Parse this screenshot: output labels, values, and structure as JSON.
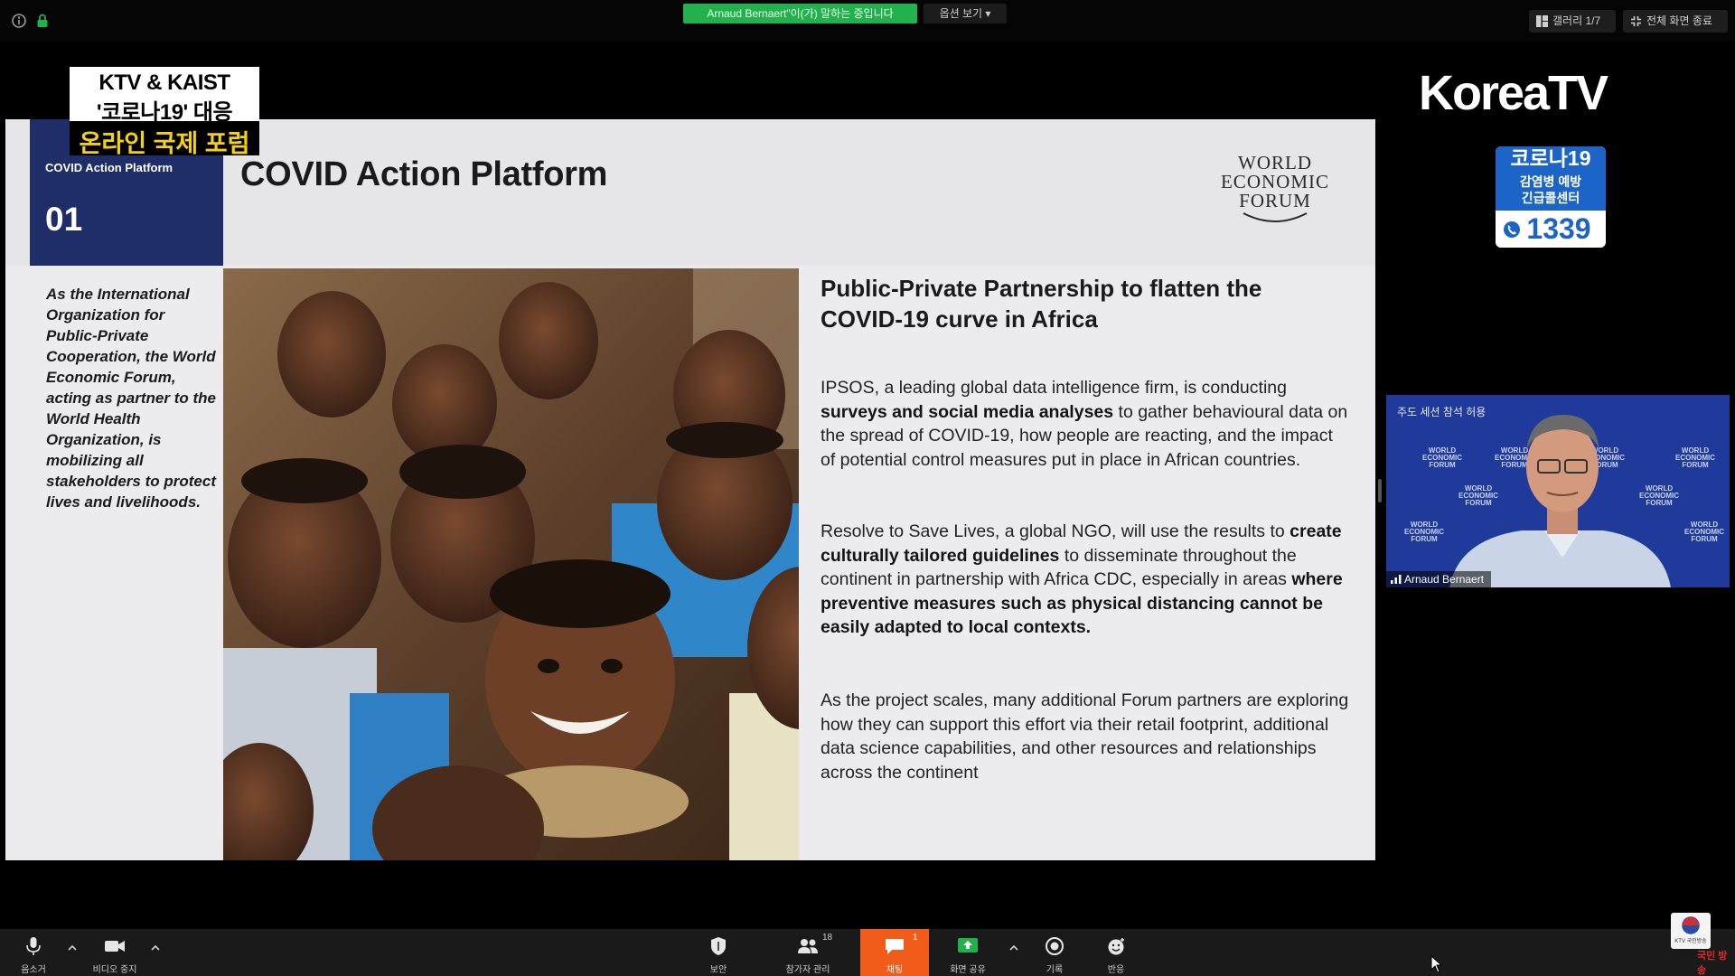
{
  "top_bar": {
    "speaking_banner": "Arnaud Bernaert\"이(가) 말하는 중입니다",
    "view_options": "옵션 보기 ▾",
    "gallery_button": "갤러리 1/7",
    "exit_fullscreen_button": "전체 화면 종료"
  },
  "overlay": {
    "forum_badge": {
      "line1": "KTV & KAIST",
      "line2": "'코로나19' 대응",
      "line3": "온라인 국제 포럼"
    },
    "channel_logo": "KoreaTV",
    "hotline": {
      "title": "코로나19",
      "subtitle_line1": "감염병 예방",
      "subtitle_line2": "긴급콜센터",
      "number": "1339"
    }
  },
  "slide": {
    "nav_label": "COVID Action Platform",
    "nav_number": "01",
    "title": "COVID Action Platform",
    "logo": {
      "line1": "WORLD",
      "line2": "ECONOMIC",
      "line3": "FORUM"
    },
    "side_text": "As the International Organization for Public-Private Cooperation, the World Economic Forum, acting as partner to the World Health Organization, is mobilizing all stakeholders to protect lives and livelihoods.",
    "heading": "Public-Private Partnership to flatten the COVID-19 curve in Africa",
    "para1": {
      "a": "IPSOS, a leading global data intelligence firm, is conducting ",
      "b": "surveys and social media analyses",
      "c": " to gather behavioural data on the spread of COVID-19, how people are reacting, and the impact of potential control measures put in place in African countries."
    },
    "para2": {
      "a": "Resolve to Save Lives, a global NGO, will use the results to ",
      "b": "create culturally tailored guidelines",
      "c": " to disseminate throughout the continent in partnership with Africa CDC, especially in areas ",
      "d": "where preventive measures such as physical distancing cannot be easily adapted to local contexts."
    },
    "para3": "As the project scales, many additional Forum partners are exploring how they can support this effort via their retail footprint, additional data science capabilities, and other resources and relationships across the continent"
  },
  "video_tile": {
    "top_label": "주도 세션 참석 허용",
    "name": "Arnaud Bernaert"
  },
  "toolbar": {
    "mute": "음소거",
    "stop_video": "비디오 중지",
    "security": "보안",
    "participants": "참가자 관리",
    "participants_count": "18",
    "chat": "채팅",
    "chat_count": "1",
    "share_screen": "화면 공유",
    "record": "기록",
    "reactions": "반응"
  },
  "corner": {
    "ktv_mark": "KTV 국민방송",
    "red_text": "국민 방송"
  },
  "colors": {
    "speaking_green": "#23b14d",
    "slide_nav_navy": "#1f2e68",
    "badge_yellow": "#f3d311",
    "hotline_blue": "#1c64c8",
    "chat_orange": "#f25c1a",
    "tile_blue": "#1f3a9a"
  }
}
